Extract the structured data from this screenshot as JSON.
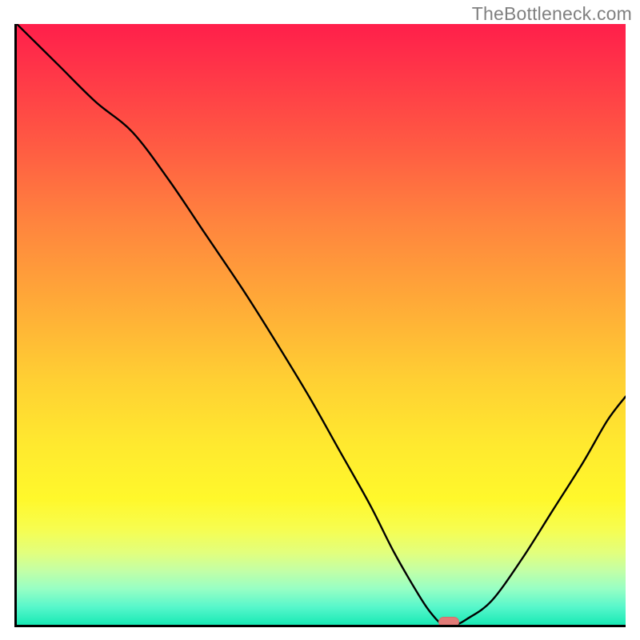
{
  "attribution": "TheBottleneck.com",
  "chart_data": {
    "type": "line",
    "title": "",
    "xlabel": "",
    "ylabel": "",
    "xlim": [
      0,
      100
    ],
    "ylim": [
      0,
      100
    ],
    "x": [
      0,
      3,
      7,
      13,
      19,
      25,
      31,
      37,
      42,
      48,
      53,
      58,
      62,
      66,
      68,
      70,
      72,
      74,
      78,
      83,
      88,
      93,
      97,
      100
    ],
    "values": [
      100,
      97,
      93,
      87,
      82,
      74,
      65,
      56,
      48,
      38,
      29,
      20,
      12,
      5,
      2,
      0,
      0,
      1,
      4,
      11,
      19,
      27,
      34,
      38
    ],
    "marker": {
      "x": 71,
      "y": 0
    },
    "notes": "V-shaped bottleneck curve over vertical rainbow gradient; minimum near x≈70–72. No axis ticks or numeric labels are shown in the image — x/y values above are estimated from the curve geometry on a 0–100 normalized scale."
  },
  "colors": {
    "gradient_top": "#ff1f4b",
    "gradient_bottom": "#18e9b5",
    "curve": "#000000",
    "marker": "#e17b77",
    "axis": "#000000",
    "attribution_text": "#808080"
  }
}
